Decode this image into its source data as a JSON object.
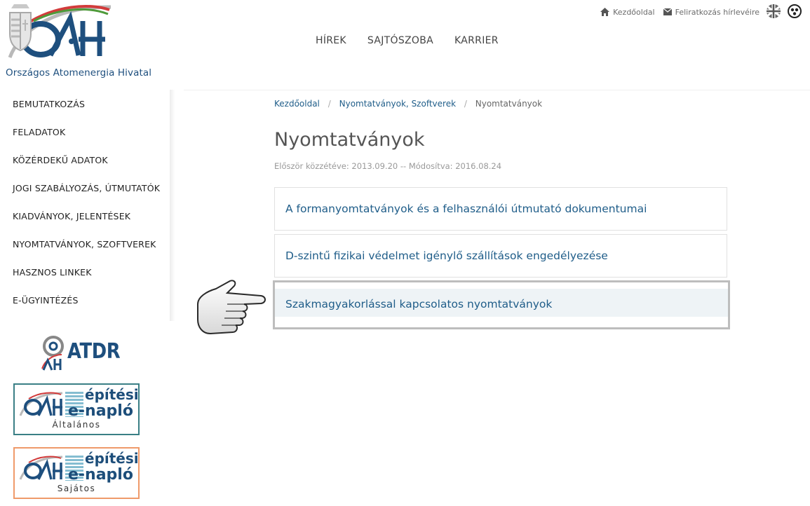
{
  "org": {
    "name": "Országos Atomenergia Hivatal",
    "logo_text": "OAH"
  },
  "util_nav": {
    "home_label": "Kezdőoldal",
    "newsletter_label": "Feliratkozás hírlevéire"
  },
  "main_nav": [
    "HÍREK",
    "SAJTÓSZOBA",
    "KARRIER"
  ],
  "sidebar": {
    "items": [
      {
        "label": "BEMUTATKOZÁS"
      },
      {
        "label": "FELADATOK"
      },
      {
        "label": "KÖZÉRDEKŰ ADATOK"
      },
      {
        "label": "JOGI SZABÁLYOZÁS, ÚTMUTATÓK"
      },
      {
        "label": "KIADVÁNYOK, JELENTÉSEK"
      },
      {
        "label": "NYOMTATVÁNYOK, SZOFTVEREK"
      },
      {
        "label": "HASZNOS LINKEK"
      },
      {
        "label": "E-ÜGYINTÉZÉS"
      }
    ]
  },
  "banners": {
    "atdr": {
      "label": "ATDR"
    },
    "general": {
      "title_1": "építési",
      "title_2": "e-napló",
      "subtitle": "Általános"
    },
    "specific": {
      "title_1": "építési",
      "title_2": "e-napló",
      "subtitle": "Sajátos"
    }
  },
  "breadcrumb": {
    "items": [
      {
        "label": "Kezdőoldal",
        "link": true
      },
      {
        "label": "Nyomtatványok, Szoftverek",
        "link": true
      },
      {
        "label": "Nyomtatványok",
        "link": false
      }
    ]
  },
  "page": {
    "title": "Nyomtatványok",
    "meta": "Először közzétéve: 2013.09.20 -- Módosítva: 2016.08.24"
  },
  "panels": [
    {
      "label": "A formanyomtatványok és a felhasználói útmutató dokumentumai"
    },
    {
      "label": "D-szintű fizikai védelmet igénylő szállítások engedélyezése"
    },
    {
      "label": "Szakmagyakorlással kapcsolatos nyomtatványok"
    }
  ],
  "colors": {
    "link": "#1f5d89",
    "brand_blue": "#1e4f7e",
    "logo_red": "#d23b3b",
    "logo_green": "#4f9a3a",
    "highlight_border": "#bdbdbd"
  }
}
